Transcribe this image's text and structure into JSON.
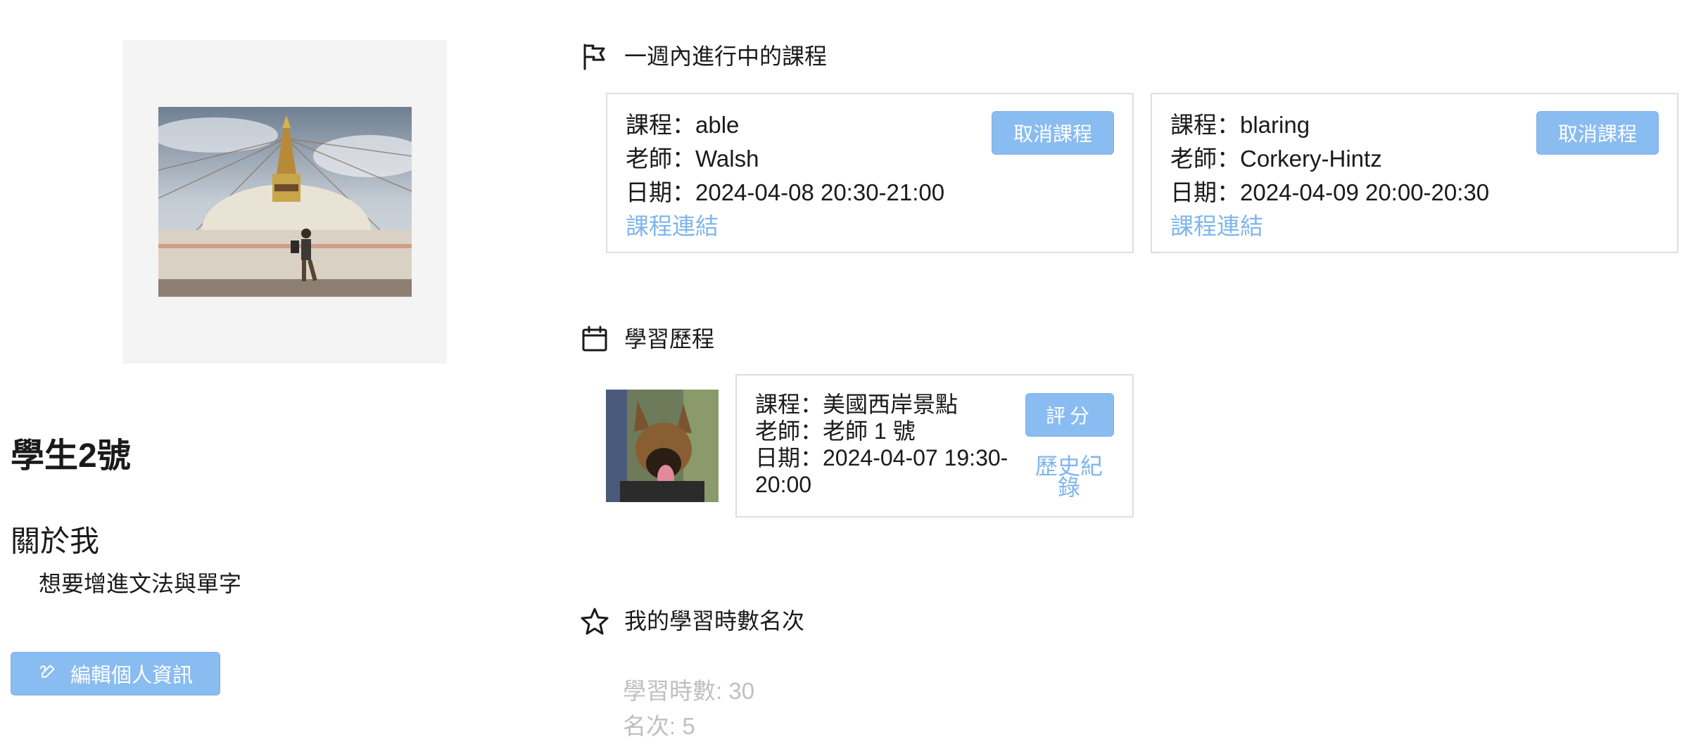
{
  "profile": {
    "name": "學生2號",
    "about_title": "關於我",
    "about_text": "想要增進文法與單字",
    "edit_button": "編輯個人資訊"
  },
  "upcoming": {
    "title": "一週內進行中的課程",
    "cards": [
      {
        "course": "課程：able",
        "teacher": "老師：Walsh",
        "date": "日期：2024-04-08 20:30-21:00",
        "link": "課程連結",
        "cancel": "取消課程"
      },
      {
        "course": "課程：blaring",
        "teacher": "老師：Corkery-Hintz",
        "date": "日期：2024-04-09 20:00-20:30",
        "link": "課程連結",
        "cancel": "取消課程"
      }
    ]
  },
  "history": {
    "title": "學習歷程",
    "cards": [
      {
        "course": "課程：美國西岸景點",
        "teacher": "老師：老師 1 號",
        "date": "日期：2024-04-07 19:30-20:00",
        "rate": "評分",
        "history_link": "歷史紀錄"
      }
    ]
  },
  "ranking": {
    "title": "我的學習時數名次",
    "hours": "學習時數: 30",
    "rank": "名次: 5"
  },
  "colors": {
    "accent_button": "#89bcf0",
    "link": "#7fb6ec",
    "muted_text": "#c0c0c0"
  },
  "icons": {
    "upcoming": "flag-icon",
    "history": "calendar-icon",
    "ranking": "star-icon",
    "edit": "edit-icon"
  }
}
